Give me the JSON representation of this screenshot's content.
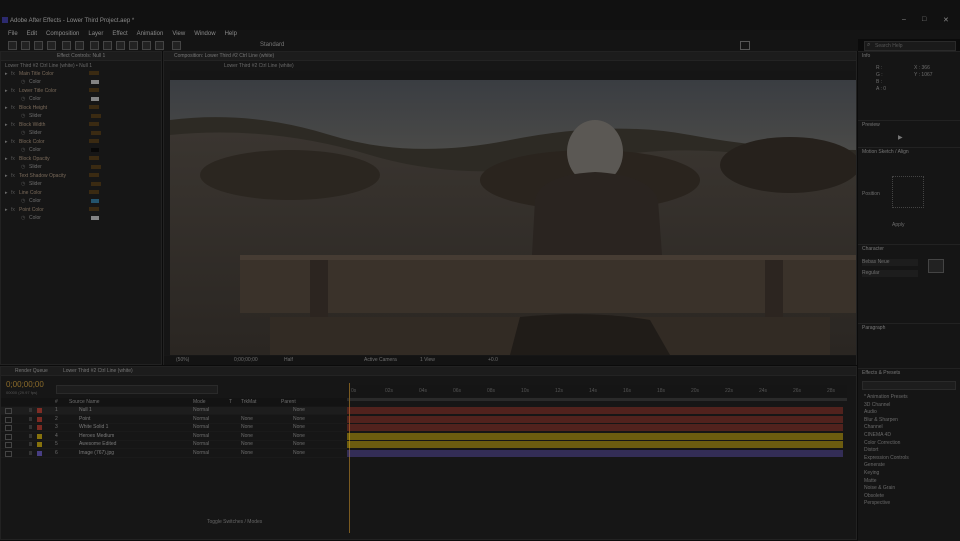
{
  "app": {
    "title": "Adobe After Effects - Lower Third Project.aep *",
    "window_controls": [
      "–",
      "□",
      "✕"
    ]
  },
  "menu": [
    "File",
    "Edit",
    "Composition",
    "Layer",
    "Effect",
    "Animation",
    "View",
    "Window",
    "Help"
  ],
  "toolbar": {
    "workspace": "Standard",
    "search_placeholder": "Search Help"
  },
  "effect_controls": {
    "tab_label": "Effect Controls: Null 1",
    "header": "Lower Third #2 Ctrl Line (white) • Null 1",
    "items": [
      {
        "label": "Main Title Color",
        "sub": "Color",
        "swatch": "#cfcfcf"
      },
      {
        "label": "Lower Title Color",
        "sub": "Color",
        "swatch": "#cfcfcf"
      },
      {
        "label": "Block Height",
        "sub": "Slider",
        "swatch": ""
      },
      {
        "label": "Block Width",
        "sub": "Slider",
        "swatch": ""
      },
      {
        "label": "Block Color",
        "sub": "Color",
        "swatch": "#000000"
      },
      {
        "label": "Block Opacity",
        "sub": "Slider",
        "swatch": ""
      },
      {
        "label": "Text Shadow Opacity",
        "sub": "Slider",
        "swatch": ""
      },
      {
        "label": "Line Color",
        "sub": "Color",
        "swatch": "#2f7fa8"
      },
      {
        "label": "Point Color",
        "sub": "Color",
        "swatch": "#cfcfcf"
      }
    ]
  },
  "composition": {
    "tab_label": "Composition: Lower Third #2 Ctrl Line (white)",
    "sub_tab": "Lower Third #2 Ctrl Line (white)",
    "zoom": "(50%)",
    "time": "0;00;00;00",
    "resolution": "Half",
    "camera": "Active Camera",
    "views": "1 View",
    "offset": "+0.0"
  },
  "info_panel": {
    "tab": "Info",
    "r": "R :",
    "g": "G :",
    "b": "B :",
    "a": "A : 0",
    "x": "X : 366",
    "y": "Y : 1067"
  },
  "preview_panel": {
    "tab": "Preview"
  },
  "align_panel": {
    "tab": "Motion Sketch / Align",
    "position_label": "Position",
    "button": "Apply"
  },
  "character_panel": {
    "tab": "Character",
    "font": "Bebas Neue",
    "style": "Regular"
  },
  "paragraph_panel": {
    "tab": "Paragraph"
  },
  "effects_presets": {
    "tab": "Effects & Presets",
    "items": [
      "* Animation Presets",
      "3D Channel",
      "Audio",
      "Blur & Sharpen",
      "Channel",
      "CINEMA 4D",
      "Color Correction",
      "Distort",
      "Expression Controls",
      "Generate",
      "Keying",
      "Matte",
      "Noise & Grain",
      "Obsolete",
      "Perspective"
    ]
  },
  "timeline": {
    "tab_label": "Lower Third #2 Ctrl Line (white)",
    "render_tab": "Render Queue",
    "timecode": "0;00;00;00",
    "fps": "00000 (29.97 fps)",
    "search_placeholder": "",
    "columns": [
      "#",
      "Source Name",
      "Mode",
      "T",
      "TrkMat",
      "Parent"
    ],
    "layers": [
      {
        "num": "1",
        "name": "Null 1",
        "mode": "Normal",
        "trkmat": "",
        "parent": "None",
        "color": "#c0392b"
      },
      {
        "num": "2",
        "name": "Point",
        "mode": "Normal",
        "trkmat": "None",
        "parent": "None",
        "color": "#c0392b"
      },
      {
        "num": "3",
        "name": "White Solid 1",
        "mode": "Normal",
        "trkmat": "None",
        "parent": "None",
        "color": "#c0392b"
      },
      {
        "num": "4",
        "name": "Heroes Medium",
        "mode": "Normal",
        "trkmat": "None",
        "parent": "None",
        "color": "#d4b106"
      },
      {
        "num": "5",
        "name": "Awesome Edited",
        "mode": "Normal",
        "trkmat": "None",
        "parent": "None",
        "color": "#d4b106"
      },
      {
        "num": "6",
        "name": "Image (767).jpg",
        "mode": "Normal",
        "trkmat": "None",
        "parent": "None",
        "color": "#6a5acd"
      }
    ],
    "ruler_ticks": [
      "0s",
      "02s",
      "04s",
      "06s",
      "08s",
      "10s",
      "12s",
      "14s",
      "16s",
      "18s",
      "20s",
      "22s",
      "24s",
      "26s",
      "28s"
    ],
    "toggle_label": "Toggle Switches / Modes"
  }
}
